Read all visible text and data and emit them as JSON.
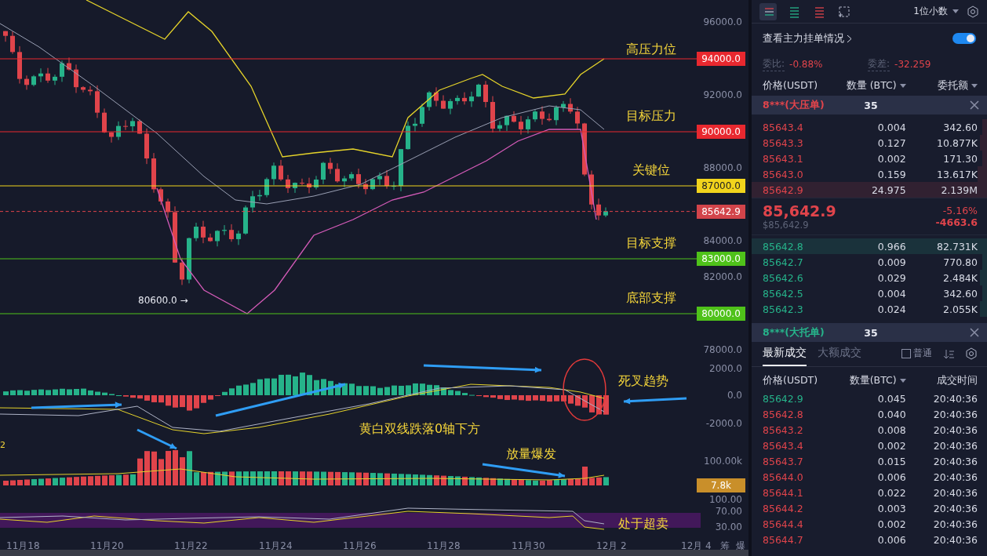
{
  "chart": {
    "price_ticks": [
      "96000.0",
      "92000.0",
      "88000.0",
      "84000.0",
      "82000.0",
      "78000.0"
    ],
    "levels": [
      {
        "label": "高压力位",
        "price": "94000.0",
        "color": "#e8282f"
      },
      {
        "label": "目标压力",
        "price": "90000.0",
        "color": "#e8282f"
      },
      {
        "label": "关键位",
        "price": "87000.0",
        "color": "#f2d41c"
      },
      {
        "label": "目标支撑",
        "price": "83000.0",
        "color": "#4fc21a"
      },
      {
        "label": "底部支撑",
        "price": "80000.0",
        "color": "#4fc21a"
      }
    ],
    "last_price": "85642.9",
    "low_marker": "80600.0 →",
    "macd": {
      "ticks": [
        "2000.0",
        "0.0",
        "-2000.0"
      ],
      "note": "黄白双线跌落0轴下方",
      "signal": "死叉趋势"
    },
    "edge_label": "2",
    "volume": {
      "tick": "100.00k",
      "last": "7.8k",
      "note": "放量爆发"
    },
    "rsi": {
      "ticks": [
        "100.00",
        "70.00",
        "30.00"
      ],
      "note": "处于超卖"
    },
    "dates": [
      "11月18",
      "11月20",
      "11月22",
      "11月24",
      "11月26",
      "11月28",
      "11月30",
      "12月 2",
      "12月 4"
    ],
    "side_buttons": [
      "筹",
      "爆"
    ]
  },
  "orderbook": {
    "layouts": [
      {
        "kind": "both",
        "selected": true
      },
      {
        "kind": "bids",
        "selected": false
      },
      {
        "kind": "asks",
        "selected": false
      },
      {
        "kind": "expand",
        "selected": false
      }
    ],
    "precision": "1位小数",
    "main_orders_label": "查看主力挂单情况",
    "main_orders_on": true,
    "ratio_label": "委比:",
    "ratio": "-0.88%",
    "diff_label": "委差:",
    "diff": "-32.259",
    "columns": [
      "价格(USDT)",
      "数量 (BTC)",
      "委托额"
    ],
    "ask_alert": {
      "label": "8***(大压单)",
      "count": "35"
    },
    "asks": [
      {
        "price": "85643.4",
        "qty": "0.004",
        "amount": "342.60",
        "level": 0.02
      },
      {
        "price": "85643.3",
        "qty": "0.127",
        "amount": "10.877K",
        "level": 0.03
      },
      {
        "price": "85643.1",
        "qty": "0.002",
        "amount": "171.30",
        "level": 0.02
      },
      {
        "price": "85643.0",
        "qty": "0.159",
        "amount": "13.617K",
        "level": 0.04
      },
      {
        "price": "85642.9",
        "qty": "24.975",
        "amount": "2.139M",
        "level": 1
      }
    ],
    "last": {
      "price": "85,642.9",
      "usd": "$85,642.9",
      "change_pct": "-5.16%",
      "change": "-4663.6"
    },
    "bids": [
      {
        "price": "85642.8",
        "qty": "0.966",
        "amount": "82.731K",
        "level": 1
      },
      {
        "price": "85642.7",
        "qty": "0.009",
        "amount": "770.80",
        "level": 0.02
      },
      {
        "price": "85642.6",
        "qty": "0.029",
        "amount": "2.484K",
        "level": 0.03
      },
      {
        "price": "85642.5",
        "qty": "0.004",
        "amount": "342.60",
        "level": 0.02
      },
      {
        "price": "85642.3",
        "qty": "0.024",
        "amount": "2.055K",
        "level": 0.03
      }
    ],
    "bid_alert": {
      "label": "8***(大托单)",
      "count": "35"
    }
  },
  "trades": {
    "tabs": [
      {
        "label": "最新成交",
        "selected": true
      },
      {
        "label": "大额成交",
        "selected": false
      }
    ],
    "mode": "普通",
    "columns": [
      "价格(USDT)",
      "数量(BTC)",
      "成交时间"
    ],
    "rows": [
      {
        "price": "85642.9",
        "qty": "0.045",
        "time": "20:40:36",
        "color": "#26b38a"
      },
      {
        "price": "85642.8",
        "qty": "0.040",
        "time": "20:40:36",
        "color": "#e0444b"
      },
      {
        "price": "85643.2",
        "qty": "0.008",
        "time": "20:40:36",
        "color": "#e0444b"
      },
      {
        "price": "85643.4",
        "qty": "0.002",
        "time": "20:40:36",
        "color": "#e0444b"
      },
      {
        "price": "85643.7",
        "qty": "0.015",
        "time": "20:40:36",
        "color": "#e0444b"
      },
      {
        "price": "85644.0",
        "qty": "0.006",
        "time": "20:40:36",
        "color": "#e0444b"
      },
      {
        "price": "85644.1",
        "qty": "0.022",
        "time": "20:40:36",
        "color": "#e0444b"
      },
      {
        "price": "85644.2",
        "qty": "0.003",
        "time": "20:40:36",
        "color": "#e0444b"
      },
      {
        "price": "85644.4",
        "qty": "0.002",
        "time": "20:40:36",
        "color": "#e0444b"
      },
      {
        "price": "85644.7",
        "qty": "0.006",
        "time": "20:40:36",
        "color": "#e0444b"
      }
    ]
  }
}
